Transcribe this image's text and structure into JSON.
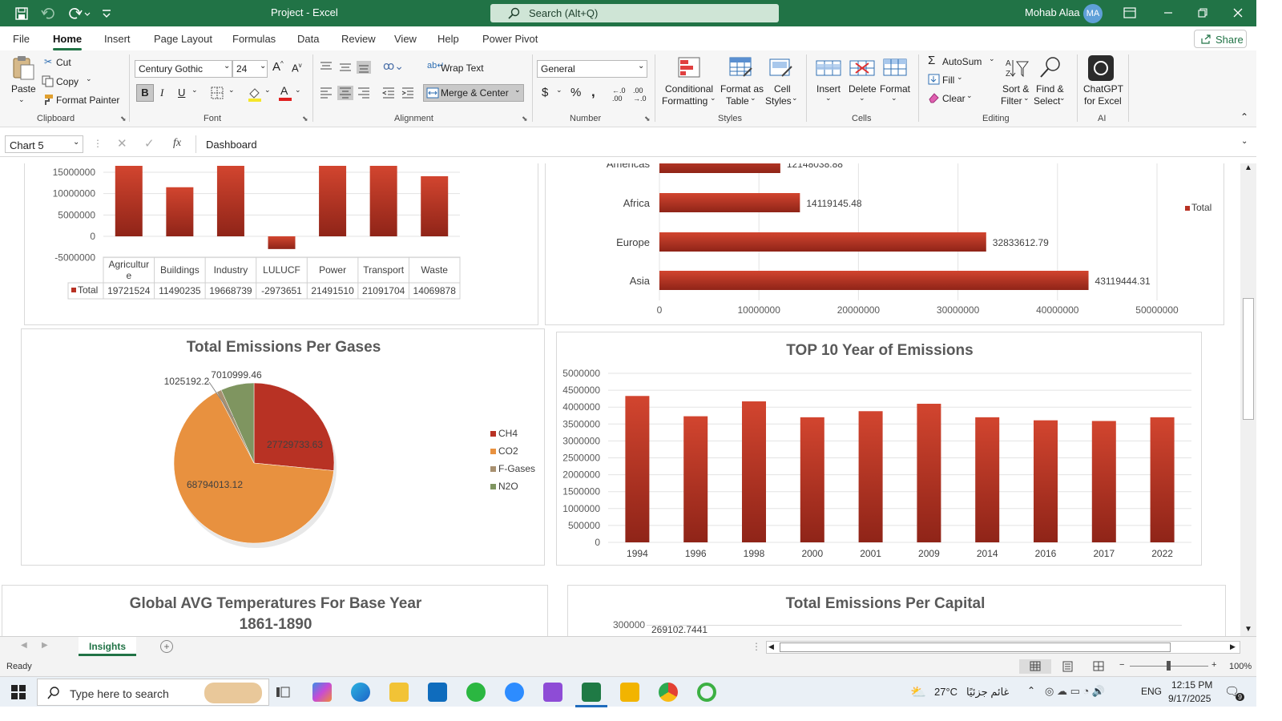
{
  "titlebar": {
    "doc_title": "Project  -  Excel",
    "search_placeholder": "Search (Alt+Q)",
    "user_name": "Mohab Alaa",
    "user_initials": "MA"
  },
  "tabs": [
    "File",
    "Home",
    "Insert",
    "Page Layout",
    "Formulas",
    "Data",
    "Review",
    "View",
    "Help",
    "Power Pivot"
  ],
  "share_label": "Share",
  "ribbon": {
    "clipboard": {
      "paste": "Paste",
      "cut": "Cut",
      "copy": "Copy",
      "format_painter": "Format Painter",
      "group": "Clipboard"
    },
    "font": {
      "family": "Century Gothic",
      "size": "24",
      "bold": "B",
      "italic": "I",
      "underline": "U",
      "group": "Font"
    },
    "alignment": {
      "wrap_text": "Wrap Text",
      "merge_center": "Merge & Center",
      "group": "Alignment"
    },
    "number": {
      "format": "General",
      "group": "Number"
    },
    "styles": {
      "conditional": "Conditional",
      "conditional2": "Formatting",
      "format_as": "Format as",
      "format_as2": "Table",
      "cell": "Cell",
      "cell2": "Styles",
      "group": "Styles"
    },
    "cells": {
      "insert": "Insert",
      "delete": "Delete",
      "format": "Format",
      "group": "Cells"
    },
    "editing": {
      "autosum": "AutoSum",
      "fill": "Fill",
      "clear": "Clear",
      "sort1": "Sort &",
      "sort2": "Filter",
      "find1": "Find &",
      "find2": "Select",
      "group": "Editing"
    },
    "ai": {
      "chatgpt1": "ChatGPT",
      "chatgpt2": "for Excel",
      "group": "AI"
    }
  },
  "formula_bar": {
    "name_box": "Chart 5",
    "fx": "fx",
    "value": "Dashboard"
  },
  "charts": {
    "sector": {
      "y_ticks": [
        "15000000",
        "10000000",
        "5000000",
        "0",
        "-5000000"
      ],
      "categories": [
        "Agricultur e",
        "Buildings",
        "Industry",
        "LULUCF",
        "Power",
        "Transport",
        "Waste"
      ],
      "legend_label": "Total",
      "values_text": [
        "19721524",
        "11490235",
        "19668739",
        "-2973651",
        "21491510",
        "21091704",
        "14069878"
      ]
    },
    "region": {
      "categories": [
        "Americas",
        "Africa",
        "Europe",
        "Asia"
      ],
      "labels": [
        "12148038.88",
        "14119145.48",
        "32833612.79",
        "43119444.31"
      ],
      "x_ticks": [
        "0",
        "10000000",
        "20000000",
        "30000000",
        "40000000",
        "50000000"
      ],
      "legend": "Total"
    },
    "gases": {
      "title": "Total Emissions Per Gases",
      "legend": [
        "CH4",
        "CO2",
        "F-Gases",
        "N2O"
      ],
      "labels": [
        "27729733.63",
        "68794013.12",
        "1025192.2",
        "7010999.46"
      ]
    },
    "years": {
      "title": "TOP 10 Year of Emissions",
      "y_ticks": [
        "5000000",
        "4500000",
        "4000000",
        "3500000",
        "3000000",
        "2500000",
        "2000000",
        "1500000",
        "1000000",
        "500000",
        "0"
      ],
      "categories": [
        "1994",
        "1996",
        "1998",
        "2000",
        "2001",
        "2009",
        "2014",
        "2016",
        "2017",
        "2022"
      ]
    },
    "temps": {
      "title": "Global AVG Temperatures For Base Year",
      "subtitle": "1861-1890"
    },
    "capital": {
      "title": "Total Emissions Per Capital",
      "y_tick": "300000",
      "label": "269102.7441"
    }
  },
  "chart_data": [
    {
      "type": "bar",
      "title": "",
      "categories": [
        "Agriculture",
        "Buildings",
        "Industry",
        "LULUCF",
        "Power",
        "Transport",
        "Waste"
      ],
      "values": [
        19721524,
        11490235,
        19668739,
        -2973651,
        21491510,
        21091704,
        14069878
      ],
      "series": [
        {
          "name": "Total",
          "values": [
            19721524,
            11490235,
            19668739,
            -2973651,
            21491510,
            21091704,
            14069878
          ]
        }
      ],
      "ylim": [
        -5000000,
        15000000
      ]
    },
    {
      "type": "bar",
      "orientation": "horizontal",
      "categories": [
        "Americas",
        "Africa",
        "Europe",
        "Asia"
      ],
      "values": [
        12148038.88,
        14119145.48,
        32833612.79,
        43119444.31
      ],
      "series": [
        {
          "name": "Total",
          "values": [
            12148038.88,
            14119145.48,
            32833612.79,
            43119444.31
          ]
        }
      ],
      "xlim": [
        0,
        50000000
      ]
    },
    {
      "type": "pie",
      "title": "Total Emissions Per Gases",
      "categories": [
        "CH4",
        "CO2",
        "F-Gases",
        "N2O"
      ],
      "values": [
        27729733.63,
        68794013.12,
        1025192.2,
        7010999.46
      ],
      "colors": [
        "#b83224",
        "#e8913f",
        "#a89070",
        "#7f9560"
      ]
    },
    {
      "type": "bar",
      "title": "TOP 10 Year of Emissions",
      "categories": [
        "1994",
        "1996",
        "1998",
        "2000",
        "2001",
        "2009",
        "2014",
        "2016",
        "2017",
        "2022"
      ],
      "values": [
        4330000,
        3730000,
        4170000,
        3700000,
        3880000,
        4100000,
        3700000,
        3610000,
        3590000,
        3700000
      ],
      "ylim": [
        0,
        5000000
      ]
    }
  ],
  "sheet_tabs": {
    "active": "Insights"
  },
  "status": {
    "ready": "Ready",
    "zoom": "100%"
  },
  "taskbar": {
    "search": "Type here to search",
    "weather": "27°C",
    "weather_desc": "غائم جزئيًا",
    "lang": "ENG",
    "time": "12:15 PM",
    "date": "9/17/2025",
    "notif": "9"
  },
  "colors": {
    "excel_green": "#217346",
    "bar_red": "#b83224"
  }
}
